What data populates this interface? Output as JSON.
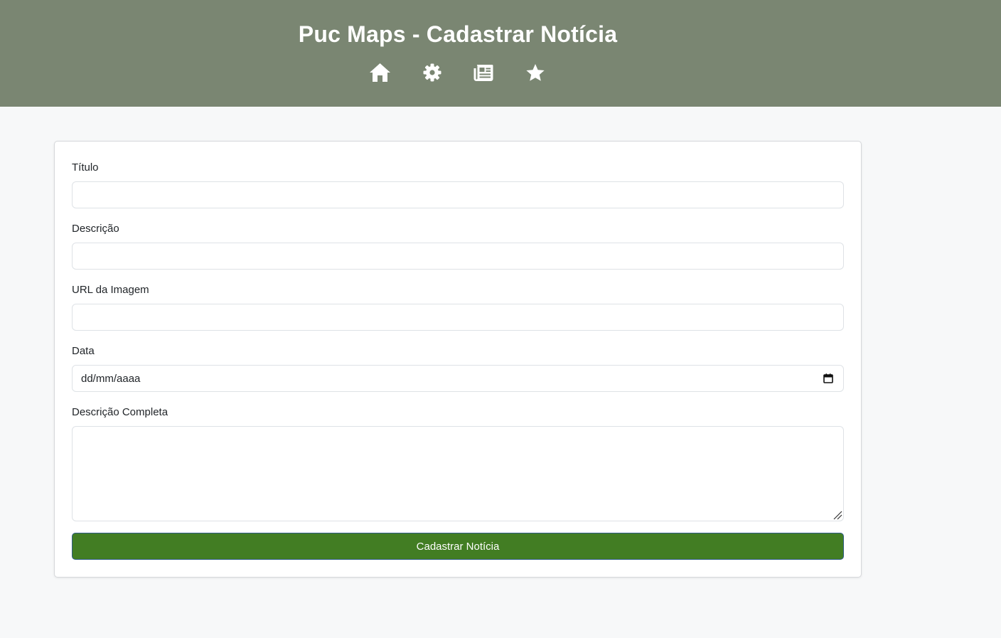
{
  "header": {
    "title": "Puc Maps - Cadastrar Notícia",
    "background_color": "#7a8672",
    "nav": [
      {
        "icon": "home-icon"
      },
      {
        "icon": "gear-icon"
      },
      {
        "icon": "newspaper-icon"
      },
      {
        "icon": "star-icon"
      }
    ]
  },
  "form": {
    "fields": {
      "titulo": {
        "label": "Título",
        "value": ""
      },
      "descricao": {
        "label": "Descrição",
        "value": ""
      },
      "url_imagem": {
        "label": "URL da Imagem",
        "value": ""
      },
      "data": {
        "label": "Data",
        "placeholder": "dd/mm/aaaa"
      },
      "descricao_completa": {
        "label": "Descrição Completa",
        "value": ""
      }
    },
    "submit_label": "Cadastrar Notícia",
    "submit_color": "#427d23"
  }
}
